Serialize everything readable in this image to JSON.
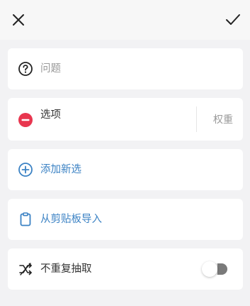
{
  "header": {
    "close_icon": "close-icon",
    "confirm_icon": "check-icon"
  },
  "question": {
    "icon": "help-circle-icon",
    "placeholder": "问题"
  },
  "option": {
    "icon": "remove-circle-icon",
    "label": "选项",
    "weight_label": "权重",
    "icon_color": "#e8364f"
  },
  "add_option": {
    "icon": "add-circle-icon",
    "label": "添加新选"
  },
  "import": {
    "icon": "clipboard-icon",
    "label": "从剪贴板导入"
  },
  "no_repeat": {
    "icon": "shuffle-icon",
    "label": "不重复抽取",
    "enabled": false
  },
  "colors": {
    "accent_blue": "#3b82c4",
    "placeholder_gray": "#9a9a9a",
    "background": "#f2f2f4"
  }
}
